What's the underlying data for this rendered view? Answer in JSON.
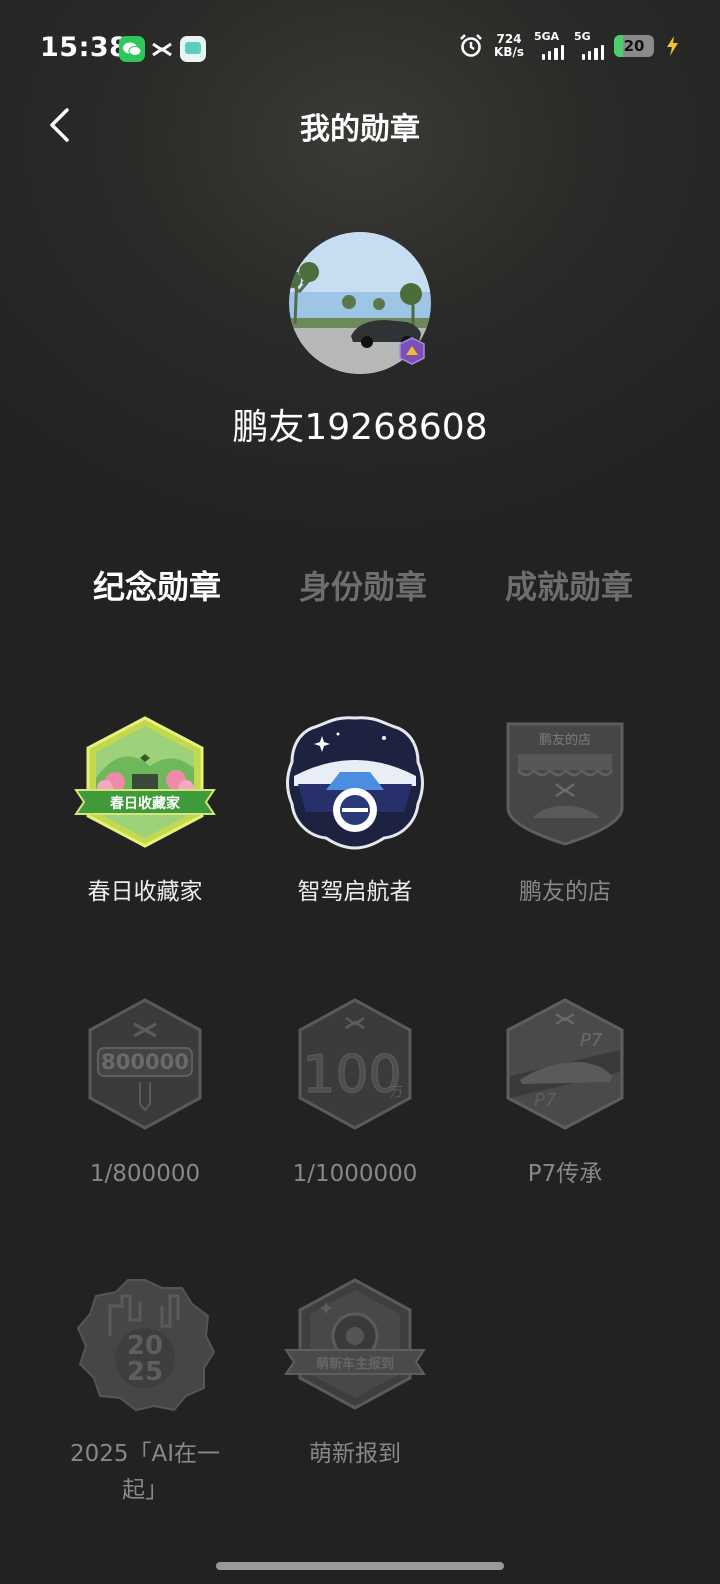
{
  "status_bar": {
    "time": "15:38",
    "net_speed_value": "724",
    "net_speed_unit": "KB/s",
    "signal1_label": "5GA",
    "signal2_label": "5G",
    "battery": "20",
    "icons": [
      "wechat-icon",
      "xpeng-icon",
      "chat-app-icon",
      "alarm-icon",
      "signal-icon",
      "charging-icon"
    ]
  },
  "header": {
    "title": "我的勋章"
  },
  "profile": {
    "username": "鹏友19268608"
  },
  "tabs": [
    {
      "label": "纪念勋章",
      "active": true
    },
    {
      "label": "身份勋章",
      "active": false
    },
    {
      "label": "成就勋章",
      "active": false
    }
  ],
  "badges": [
    {
      "label": "春日收藏家",
      "earned": true,
      "ribbon": "春日收藏家"
    },
    {
      "label": "智驾启航者",
      "earned": true
    },
    {
      "label": "鹏友的店",
      "earned": false,
      "banner": "鹏友的店"
    },
    {
      "label": "1/800000",
      "earned": false,
      "number": "800000"
    },
    {
      "label": "1/1000000",
      "earned": false,
      "number": "100",
      "unit": "万"
    },
    {
      "label": "P7传承",
      "earned": false,
      "mark": "P7"
    },
    {
      "label": "2025「AI在一起」",
      "earned": false,
      "year_top": "20",
      "year_bottom": "25"
    },
    {
      "label": "萌新报到",
      "earned": false,
      "ribbon": "萌新车主报到"
    }
  ]
}
